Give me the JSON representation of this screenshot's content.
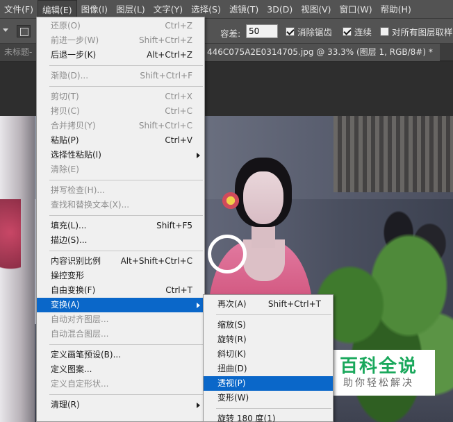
{
  "menubar": {
    "items": [
      "文件(F)",
      "编辑(E)",
      "图像(I)",
      "图层(L)",
      "文字(Y)",
      "选择(S)",
      "滤镜(T)",
      "3D(D)",
      "视图(V)",
      "窗口(W)",
      "帮助(H)"
    ],
    "active_index": 1
  },
  "options": {
    "tolerance_label": "容差:",
    "tolerance_value": "50",
    "antialias_label": "消除锯齿",
    "antialias_checked": true,
    "contiguous_label": "连续",
    "contiguous_checked": true,
    "all_layers_label": "对所有图层取样",
    "all_layers_checked": false
  },
  "tabs": {
    "left_label": "未标题-",
    "active_label": "446C075A2E0314705.jpg @ 33.3% (图层 1, RGB/8#) *"
  },
  "edit_menu": {
    "items": [
      {
        "label": "还原(O)",
        "shortcut": "Ctrl+Z",
        "disabled": true
      },
      {
        "label": "前进一步(W)",
        "shortcut": "Shift+Ctrl+Z",
        "disabled": true
      },
      {
        "label": "后退一步(K)",
        "shortcut": "Alt+Ctrl+Z",
        "disabled": false
      },
      {
        "sep": true
      },
      {
        "label": "渐隐(D)...",
        "shortcut": "Shift+Ctrl+F",
        "disabled": true
      },
      {
        "sep": true
      },
      {
        "label": "剪切(T)",
        "shortcut": "Ctrl+X",
        "disabled": true
      },
      {
        "label": "拷贝(C)",
        "shortcut": "Ctrl+C",
        "disabled": true
      },
      {
        "label": "合并拷贝(Y)",
        "shortcut": "Shift+Ctrl+C",
        "disabled": true
      },
      {
        "label": "粘贴(P)",
        "shortcut": "Ctrl+V",
        "disabled": false
      },
      {
        "label": "选择性粘贴(I)",
        "shortcut": "",
        "disabled": false,
        "submenu": true
      },
      {
        "label": "清除(E)",
        "shortcut": "",
        "disabled": true
      },
      {
        "sep": true
      },
      {
        "label": "拼写检查(H)...",
        "shortcut": "",
        "disabled": true
      },
      {
        "label": "查找和替换文本(X)...",
        "shortcut": "",
        "disabled": true
      },
      {
        "sep": true
      },
      {
        "label": "填充(L)...",
        "shortcut": "Shift+F5",
        "disabled": false
      },
      {
        "label": "描边(S)...",
        "shortcut": "",
        "disabled": false
      },
      {
        "sep": true
      },
      {
        "label": "内容识别比例",
        "shortcut": "Alt+Shift+Ctrl+C",
        "disabled": false
      },
      {
        "label": "操控变形",
        "shortcut": "",
        "disabled": false
      },
      {
        "label": "自由变换(F)",
        "shortcut": "Ctrl+T",
        "disabled": false
      },
      {
        "label": "变换(A)",
        "shortcut": "",
        "disabled": false,
        "submenu": true,
        "highlight": true
      },
      {
        "label": "自动对齐图层...",
        "shortcut": "",
        "disabled": true
      },
      {
        "label": "自动混合图层...",
        "shortcut": "",
        "disabled": true
      },
      {
        "sep": true
      },
      {
        "label": "定义画笔预设(B)...",
        "shortcut": "",
        "disabled": false
      },
      {
        "label": "定义图案...",
        "shortcut": "",
        "disabled": false
      },
      {
        "label": "定义自定形状...",
        "shortcut": "",
        "disabled": true
      },
      {
        "sep": true
      },
      {
        "label": "清理(R)",
        "shortcut": "",
        "disabled": false,
        "submenu": true
      }
    ]
  },
  "transform_submenu": {
    "items": [
      {
        "label": "再次(A)",
        "shortcut": "Shift+Ctrl+T",
        "disabled": false
      },
      {
        "sep": true
      },
      {
        "label": "缩放(S)",
        "shortcut": "",
        "disabled": false
      },
      {
        "label": "旋转(R)",
        "shortcut": "",
        "disabled": false
      },
      {
        "label": "斜切(K)",
        "shortcut": "",
        "disabled": false
      },
      {
        "label": "扭曲(D)",
        "shortcut": "",
        "disabled": false
      },
      {
        "label": "透视(P)",
        "shortcut": "",
        "disabled": false,
        "highlight": true
      },
      {
        "label": "变形(W)",
        "shortcut": "",
        "disabled": false
      },
      {
        "sep": true
      },
      {
        "label": "旋转 180 度(1)",
        "shortcut": "",
        "disabled": false
      }
    ]
  },
  "watermark": {
    "title": "百科全说",
    "subtitle": "助你轻松解决"
  },
  "colors": {
    "menubar_bg": "#535353",
    "menu_bg": "#f0f0f0",
    "menu_highlight": "#0a67c9",
    "watermark_green": "#1aa85c"
  }
}
